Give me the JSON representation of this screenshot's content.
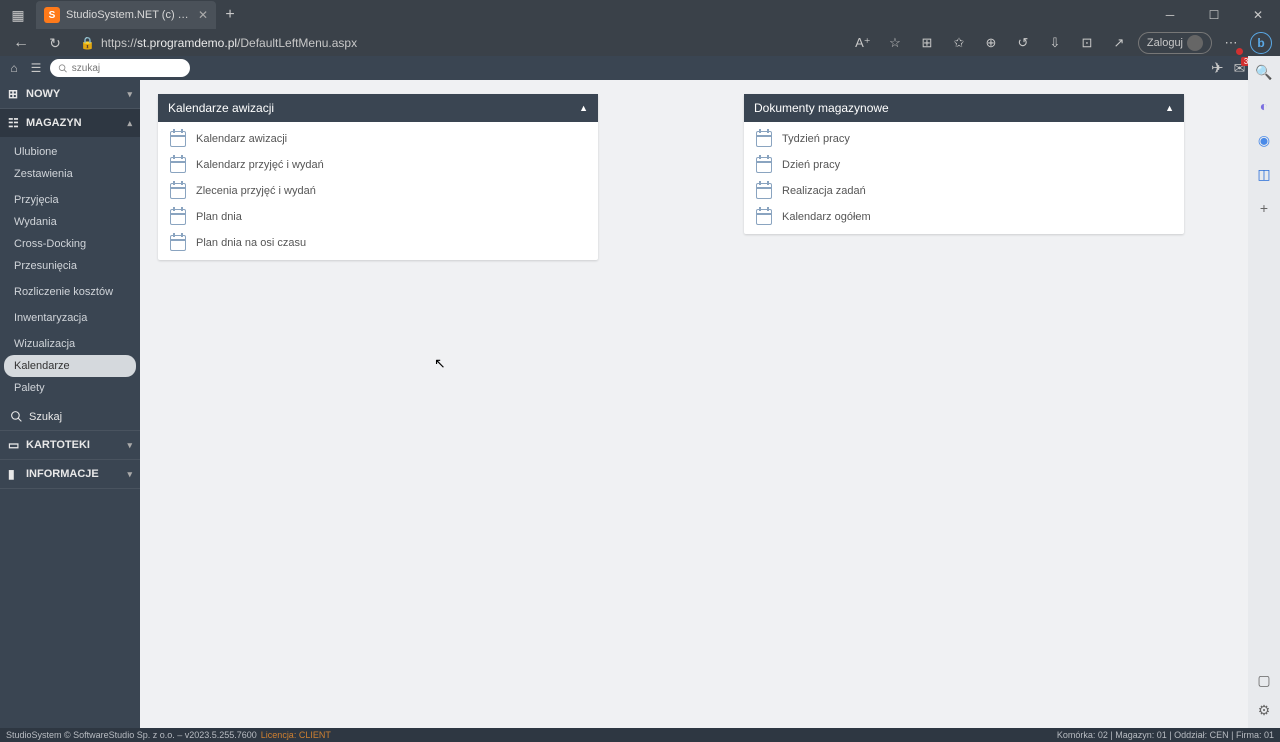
{
  "tab_title": "StudioSystem.NET (c) SoftwareS...",
  "url_host": "st.programdemo.pl",
  "url_path": "/DefaultLeftMenu.aspx",
  "login_label": "Zaloguj",
  "search_placeholder": "szukaj",
  "envelope_badge": "3",
  "nav": {
    "nowy": "NOWY",
    "magazyn": "MAGAZYN",
    "kartoteki": "KARTOTEKI",
    "informacje": "INFORMACJE",
    "szukaj": "Szukaj",
    "items": [
      "Ulubione",
      "Zestawienia",
      "Przyjęcia",
      "Wydania",
      "Cross-Docking",
      "Przesunięcia",
      "Rozliczenie kosztów",
      "Inwentaryzacja",
      "Wizualizacja",
      "Kalendarze",
      "Palety"
    ]
  },
  "panel1": {
    "title": "Kalendarze awizacji",
    "items": [
      "Kalendarz awizacji",
      "Kalendarz przyjęć i wydań",
      "Zlecenia przyjęć i wydań",
      "Plan dnia",
      "Plan dnia na osi czasu"
    ]
  },
  "panel2": {
    "title": "Dokumenty magazynowe",
    "items": [
      "Tydzień pracy",
      "Dzień pracy",
      "Realizacja zadań",
      "Kalendarz ogółem"
    ]
  },
  "status": {
    "left1": "StudioSystem © SoftwareStudio Sp. z o.o. – v2023.5.255.7600",
    "license": "Licencja: CLIENT",
    "right": "Komórka: 02 | Magazyn: 01 | Oddział: CEN | Firma: 01"
  }
}
